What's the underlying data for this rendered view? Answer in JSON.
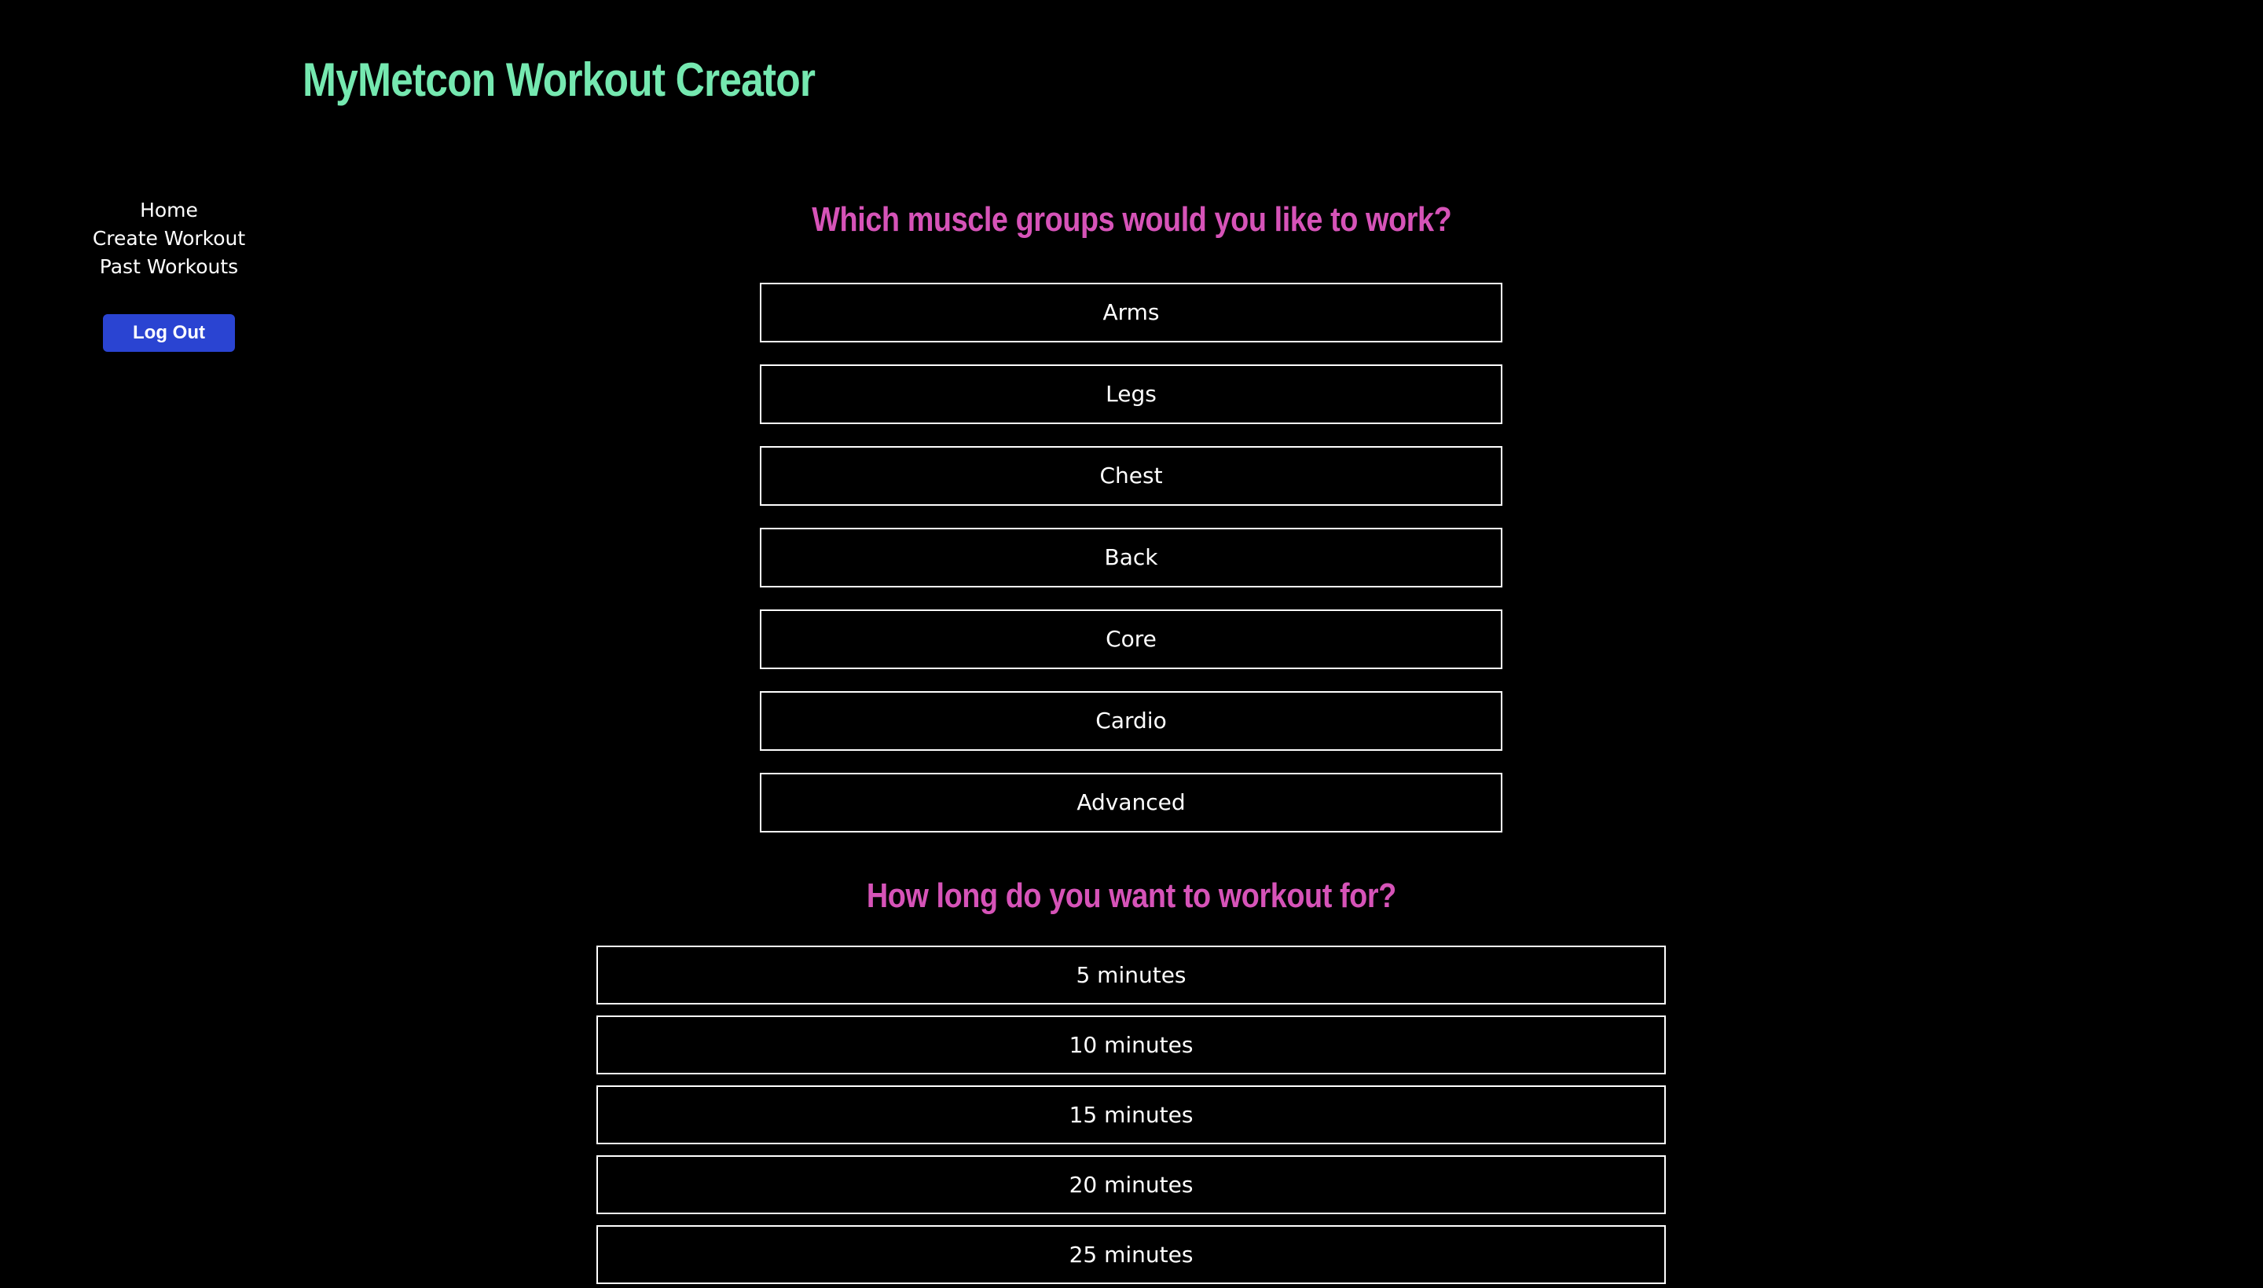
{
  "app": {
    "title": "MyMetcon Workout Creator"
  },
  "sidebar": {
    "nav": [
      {
        "label": "Home"
      },
      {
        "label": "Create Workout"
      },
      {
        "label": "Past Workouts"
      }
    ],
    "logout_label": "Log Out"
  },
  "muscle_section": {
    "question": "Which muscle groups would you like to work?",
    "options": [
      {
        "label": "Arms"
      },
      {
        "label": "Legs"
      },
      {
        "label": "Chest"
      },
      {
        "label": "Back"
      },
      {
        "label": "Core"
      },
      {
        "label": "Cardio"
      },
      {
        "label": "Advanced"
      }
    ]
  },
  "duration_section": {
    "question": "How long do you want to workout for?",
    "options": [
      {
        "label": "5 minutes"
      },
      {
        "label": "10 minutes"
      },
      {
        "label": "15 minutes"
      },
      {
        "label": "20 minutes"
      },
      {
        "label": "25 minutes"
      }
    ]
  },
  "colors": {
    "background": "#000000",
    "title": "#75e8b0",
    "question": "#d653b8",
    "logout_button": "#2a44d2",
    "option_border": "#ffffff"
  }
}
